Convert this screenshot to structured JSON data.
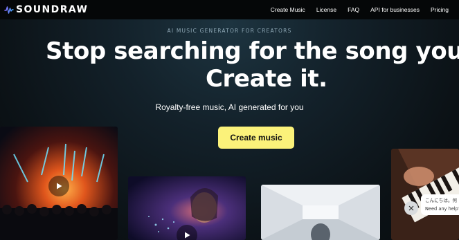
{
  "brand": {
    "name": "SOUNDRAW"
  },
  "nav": {
    "links": [
      "Create Music",
      "License",
      "FAQ",
      "API for businesses",
      "Pricing"
    ]
  },
  "hero": {
    "eyebrow": "AI MUSIC GENERATOR FOR CREATORS",
    "headline_line1": "Stop searching for the song you need.",
    "headline_line2": "Create it.",
    "subtitle": "Royalty-free music, AI generated for you",
    "cta_label": "Create music"
  },
  "chat": {
    "greeting": "こんにちは。何",
    "prompt": "Need any help?"
  },
  "colors": {
    "cta_background": "#fbf27a",
    "page_background": "#0c1217",
    "eyebrow_text": "#8fa8b6"
  },
  "icons": {
    "play": "play-icon",
    "close": "close-icon",
    "logo": "soundwave-logo-icon"
  }
}
